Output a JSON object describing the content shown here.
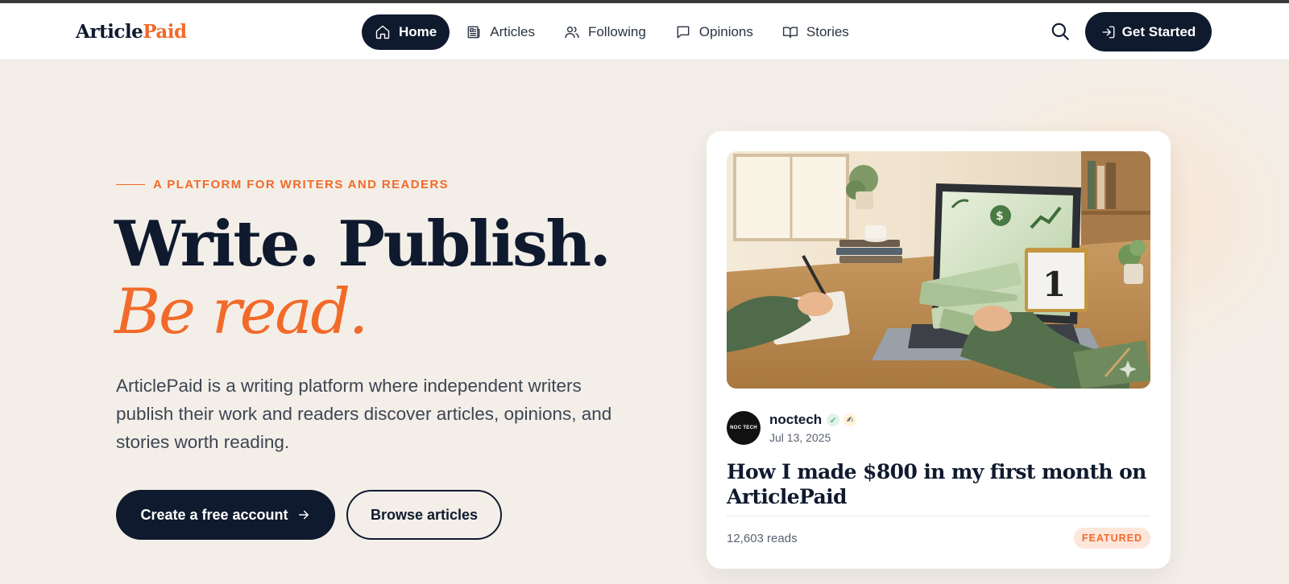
{
  "brand": {
    "part1": "Article",
    "part2": "Paid"
  },
  "nav": {
    "items": [
      {
        "label": "Home",
        "icon": "home-icon",
        "active": true
      },
      {
        "label": "Articles",
        "icon": "newspaper-icon",
        "active": false
      },
      {
        "label": "Following",
        "icon": "users-icon",
        "active": false
      },
      {
        "label": "Opinions",
        "icon": "message-icon",
        "active": false
      },
      {
        "label": "Stories",
        "icon": "book-open-icon",
        "active": false
      }
    ],
    "search_icon": "search-icon",
    "cta_label": "Get Started",
    "cta_icon": "login-icon"
  },
  "hero": {
    "eyebrow": "A PLATFORM FOR WRITERS AND READERS",
    "headline_main": "Write. Publish.",
    "headline_accent": "Be read.",
    "lede": "ArticlePaid is a writing platform where independent writers publish their work and readers discover articles, opinions, and stories worth reading.",
    "primary_button": "Create a free account",
    "primary_icon": "arrow-right-icon",
    "secondary_button": "Browse articles"
  },
  "featured_card": {
    "avatar_text": "NOC TECH",
    "author": "noctech",
    "verified_icon": "verified-check-icon",
    "author_badge": "✍",
    "date": "Jul 13, 2025",
    "title": "How I made $800 in my first month on ArticlePaid",
    "reads": "12,603 reads",
    "badge": "FEATURED"
  },
  "colors": {
    "navy": "#0f1a2e",
    "accent": "#f26a2a",
    "background": "#f3efe8",
    "card": "#ffffff"
  }
}
